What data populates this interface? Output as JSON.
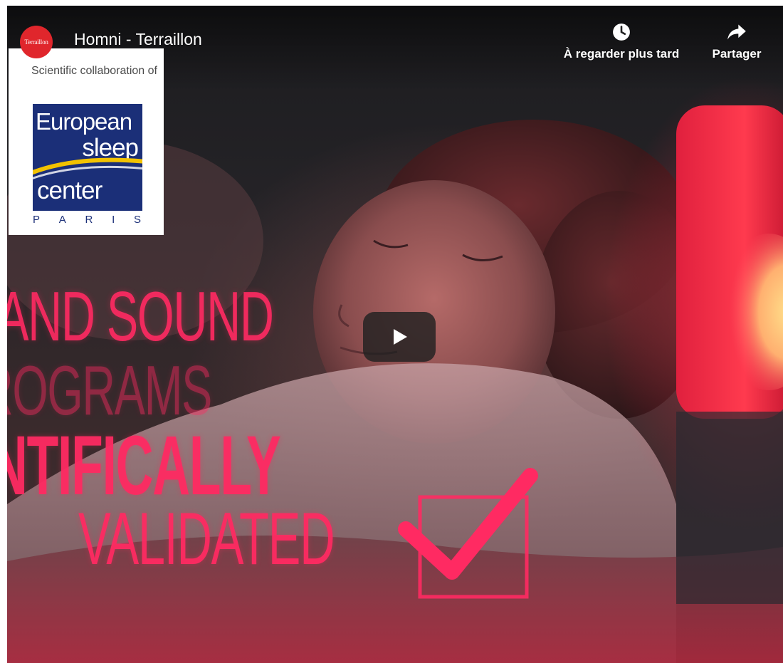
{
  "player": {
    "channel_logo_text": "Terraillon",
    "title": "Homni - Terraillon",
    "watch_later_label": "À regarder plus tard",
    "share_label": "Partager",
    "play_icon": "play-icon"
  },
  "overlay_badge": {
    "caption": "Scientific collaboration of",
    "logo_words": [
      "European",
      "sleep",
      "center"
    ],
    "logo_city_letters": [
      "P",
      "A",
      "R",
      "I",
      "S"
    ]
  },
  "video_frame_text": {
    "line1": "AND SOUND",
    "line2": "ROGRAMS",
    "line3": "NTIFICALLY",
    "line4": "VALIDATED"
  },
  "colors": {
    "promo_text": "#ff2a62",
    "logo_blue": "#1b2f78",
    "channel_red": "#e0262c"
  }
}
